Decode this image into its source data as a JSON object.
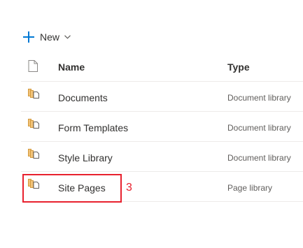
{
  "toolbar": {
    "new_label": "New"
  },
  "columns": {
    "name": "Name",
    "type": "Type"
  },
  "rows": [
    {
      "name": "Documents",
      "type": "Document library"
    },
    {
      "name": "Form Templates",
      "type": "Document library"
    },
    {
      "name": "Style Library",
      "type": "Document library"
    },
    {
      "name": "Site Pages",
      "type": "Page library"
    }
  ],
  "annotation": {
    "number": "3",
    "color": "#e8212e"
  },
  "colors": {
    "accent": "#0078d4",
    "library_icon": "#d39a3d"
  }
}
